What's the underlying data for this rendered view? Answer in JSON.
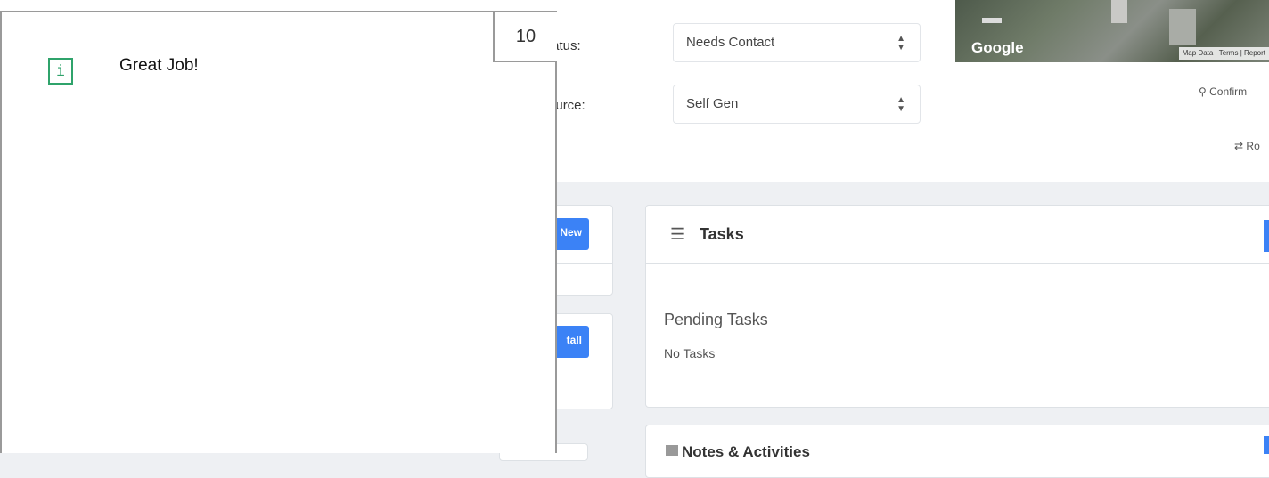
{
  "overlay": {
    "message": "Great Job!",
    "step_number": "10",
    "info_icon_glyph": "i"
  },
  "background": {
    "status_label": "Status:",
    "status_value": "Needs Contact",
    "source_label": "Source:",
    "source_value": "Self Gen",
    "map": {
      "brand": "Google",
      "attribution": "Map Data | Terms | Report"
    },
    "confirm_link": "Confirm",
    "route_link": "Ro",
    "new_button": "New",
    "install_button": "tall",
    "tasks": {
      "title": "Tasks",
      "pending_title": "Pending Tasks",
      "pending_empty": "No Tasks"
    },
    "notes": {
      "title": "Notes & Activities"
    }
  },
  "colors": {
    "accent_blue": "#3b82f6",
    "info_green": "#2fa36b",
    "border_gray": "#9a9a9a"
  }
}
